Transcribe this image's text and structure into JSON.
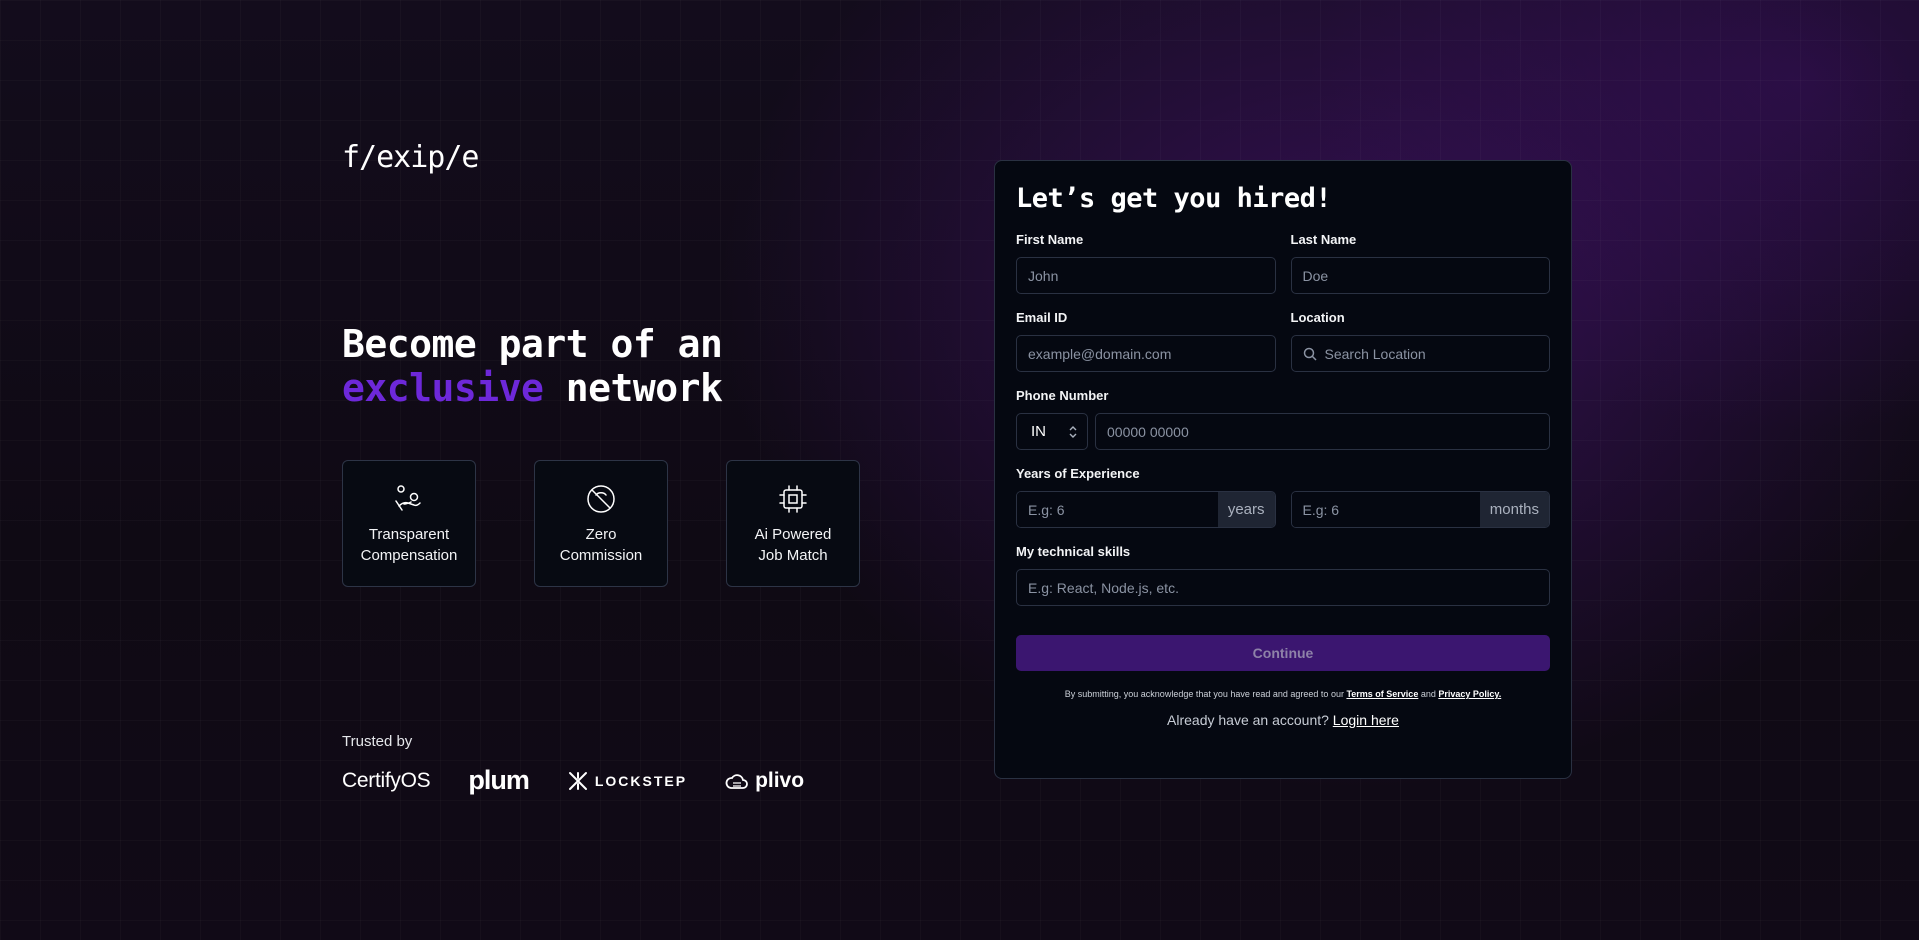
{
  "brand": {
    "logo_text": "f/exip/e"
  },
  "hero": {
    "line1": "Become part of an",
    "accent": "exclusive",
    "rest": " network"
  },
  "features": [
    {
      "icon": "hand-coin-icon",
      "label": "Transparent\nCompensation"
    },
    {
      "icon": "no-commission-icon",
      "label": "Zero\nCommission"
    },
    {
      "icon": "cpu-chip-icon",
      "label": "Ai Powered\nJob Match"
    }
  ],
  "trusted": {
    "label": "Trusted by",
    "logos": [
      "CertifyOS",
      "plum",
      "LOCKSTEP",
      "plivo"
    ]
  },
  "form": {
    "title": "Let’s get you hired!",
    "first_name": {
      "label": "First Name",
      "placeholder": "John"
    },
    "last_name": {
      "label": "Last Name",
      "placeholder": "Doe"
    },
    "email": {
      "label": "Email ID",
      "placeholder": "example@domain.com"
    },
    "location": {
      "label": "Location",
      "placeholder": "Search Location"
    },
    "phone": {
      "label": "Phone Number",
      "country": "IN",
      "placeholder": "00000 00000"
    },
    "experience": {
      "label": "Years of Experience",
      "years_placeholder": "E.g: 6",
      "years_unit": "years",
      "months_placeholder": "E.g: 6",
      "months_unit": "months"
    },
    "skills": {
      "label": "My technical skills",
      "placeholder": "E.g: React, Node.js, etc."
    },
    "submit_label": "Continue",
    "legal_prefix": "By submitting, you acknowledge that you have read and agreed to our ",
    "terms_label": "Terms of Service",
    "legal_and": " and ",
    "privacy_label": "Privacy Policy.",
    "login_prompt": "Already have an account? ",
    "login_label": "Login here"
  },
  "colors": {
    "accent": "#6d28d9",
    "button": "#3b1670",
    "card": "#050811"
  }
}
